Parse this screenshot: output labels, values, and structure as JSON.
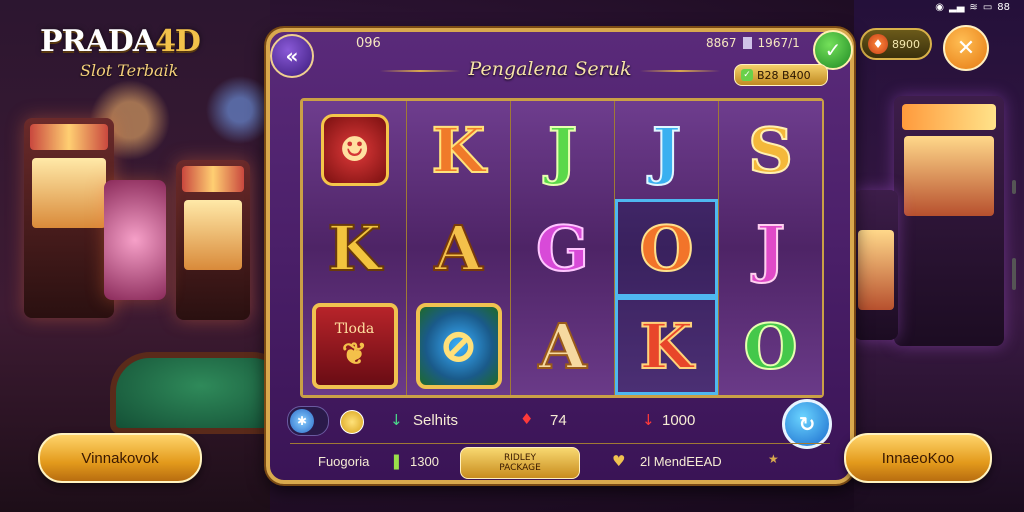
{
  "status_bar": {
    "icons": [
      "location-icon",
      "signal-icon",
      "wifi-icon",
      "battery-icon"
    ],
    "battery": "88"
  },
  "logo": {
    "name_white": "PRADA",
    "name_gold": "4D",
    "tagline": "Slot Terbaik"
  },
  "top_bar": {
    "left_value": "096",
    "mid_value_a": "8867",
    "mid_value_b": "1967/1",
    "title": "Pengalena Seruk",
    "balance": "B28 B400",
    "coin_value": "8900"
  },
  "reels": [
    [
      "mask",
      "K",
      "card"
    ],
    [
      "K",
      "A",
      "shield"
    ],
    [
      "J",
      "G",
      "A"
    ],
    [
      "J",
      "O",
      "K"
    ],
    [
      "S",
      "J",
      "O"
    ]
  ],
  "reel_labels": {
    "card_text": "Tloda"
  },
  "controls": {
    "label_1": "Selhits",
    "value_2": "74",
    "value_3": "1000",
    "label_bottom_1": "Fuogoria",
    "value_bottom_2": "1300",
    "sub_button": "RIDLEY PACKAGE",
    "label_bottom_3": "2l MendEEAD"
  },
  "buttons": {
    "left_pill": "Vinnakovok",
    "right_pill": "InnaeoKoo"
  },
  "colors": {
    "frame_gold": "#d9a94e",
    "panel_purple": "#5a2a7a",
    "accent_orange": "#e67a12"
  }
}
